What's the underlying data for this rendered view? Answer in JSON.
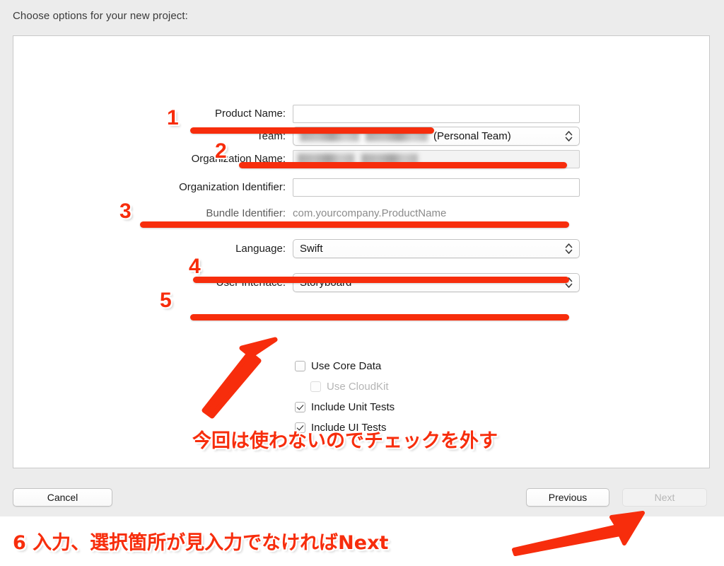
{
  "sheet": {
    "title": "Choose options for your new project:"
  },
  "form": {
    "fields": [
      {
        "label": "Product Name:",
        "type": "text",
        "value": "",
        "placeholder": ""
      },
      {
        "label": "Team:",
        "type": "popup",
        "value": "(Personal Team)",
        "redacted": true
      },
      {
        "label": "Organization Name:",
        "type": "text",
        "value": "",
        "readonly": true,
        "redacted": true
      },
      {
        "label": "Organization Identifier:",
        "type": "text",
        "value": "",
        "placeholder": ""
      },
      {
        "label": "Bundle Identifier:",
        "type": "static",
        "value": "com.yourcompany.ProductName"
      },
      {
        "label": "Language:",
        "type": "popup",
        "value": "Swift"
      },
      {
        "label": "User Interface:",
        "type": "popup",
        "value": "Storyboard"
      }
    ],
    "checkboxes": [
      {
        "label": "Use Core Data",
        "checked": false,
        "disabled": false,
        "indent": false
      },
      {
        "label": "Use CloudKit",
        "checked": false,
        "disabled": true,
        "indent": true
      },
      {
        "label": "Include Unit Tests",
        "checked": true,
        "disabled": false,
        "indent": false
      },
      {
        "label": "Include UI Tests",
        "checked": true,
        "disabled": false,
        "indent": false
      }
    ]
  },
  "buttons": {
    "cancel": "Cancel",
    "previous": "Previous",
    "next": "Next"
  },
  "annotations": {
    "accent_color": "#f72d0c",
    "numbers": [
      "1",
      "2",
      "3",
      "4",
      "5"
    ],
    "note_checkbox": "今回は使わないのでチェックを外す",
    "note_bottom": "6 入力、選択箇所が見入力でなければNext"
  }
}
